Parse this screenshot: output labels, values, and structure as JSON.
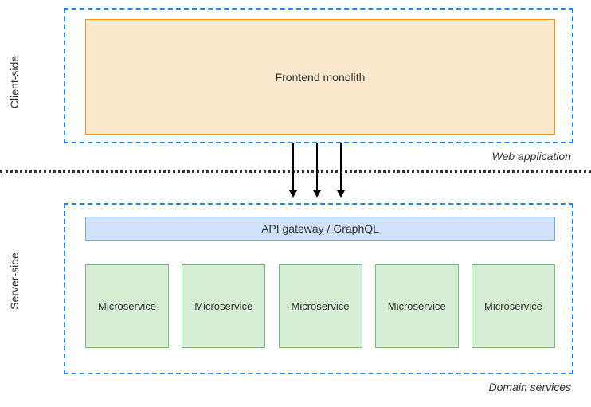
{
  "sideLabels": {
    "client": "Client-side",
    "server": "Server-side"
  },
  "clientContainer": {
    "frontendLabel": "Frontend monolith",
    "caption": "Web application"
  },
  "serverContainer": {
    "apiLabel": "API gateway / GraphQL",
    "microservices": [
      "Microservice",
      "Microservice",
      "Microservice",
      "Microservice",
      "Microservice"
    ],
    "caption": "Domain services"
  },
  "arrowCount": 3
}
